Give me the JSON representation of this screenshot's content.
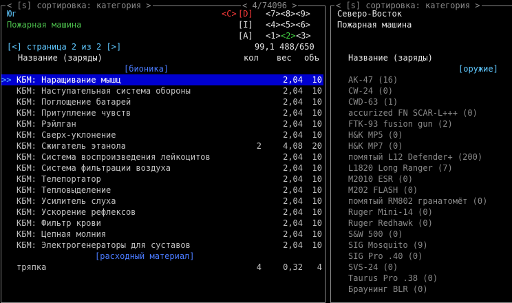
{
  "left_panel": {
    "header": "< [s] сортировка: категория >",
    "counter": "< 4/74096 >",
    "location": "Юг",
    "vehicle": "Пожарная машина",
    "key_c": "<C>",
    "key_d": "[D]",
    "key_i": "[I]",
    "key_a": "[A]",
    "nums_row1": "<7><8><9>",
    "nums_row2": "<4><5><6>",
    "nums_row3_a": "<1>",
    "nums_row3_b": "<2>",
    "nums_row3_c": "<3>",
    "page_nav": "[<] страница 2 из 2 [>]",
    "totals": "99,1 488/650",
    "col_name": "Название (заряды)",
    "col_kol": "кол",
    "col_ves": "вес",
    "col_obj": "объ",
    "category_bionics": "[бионика]",
    "category_consumable": "[расходный материал]",
    "selection_marker": ">>",
    "items": [
      {
        "name": "КБМ: Наращивание мышц",
        "kol": "",
        "ves": "2,04",
        "obj": "10"
      },
      {
        "name": "КБМ: Наступательная система обороны",
        "kol": "",
        "ves": "2,04",
        "obj": "10"
      },
      {
        "name": "КБМ: Поглощение батарей",
        "kol": "",
        "ves": "2,04",
        "obj": "10"
      },
      {
        "name": "КБМ: Притупление чувств",
        "kol": "",
        "ves": "2,04",
        "obj": "10"
      },
      {
        "name": "КБМ: Рэйлган",
        "kol": "",
        "ves": "2,04",
        "obj": "10"
      },
      {
        "name": "КБМ: Сверх-уклонение",
        "kol": "",
        "ves": "2,04",
        "obj": "10"
      },
      {
        "name": "КБМ: Сжигатель этанола",
        "kol": "2",
        "ves": "4,08",
        "obj": "20"
      },
      {
        "name": "КБМ: Система воспроизведения лейкоцитов",
        "kol": "",
        "ves": "2,04",
        "obj": "10"
      },
      {
        "name": "КБМ: Система фильтрации воздуха",
        "kol": "",
        "ves": "2,04",
        "obj": "10"
      },
      {
        "name": "КБМ: Телепортатор",
        "kol": "",
        "ves": "2,04",
        "obj": "10"
      },
      {
        "name": "КБМ: Тепловыделение",
        "kol": "",
        "ves": "2,04",
        "obj": "10"
      },
      {
        "name": "КБМ: Усилитель слуха",
        "kol": "",
        "ves": "2,04",
        "obj": "10"
      },
      {
        "name": "КБМ: Ускорение рефлексов",
        "kol": "",
        "ves": "2,04",
        "obj": "10"
      },
      {
        "name": "КБМ: Фильтр крови",
        "kol": "",
        "ves": "2,04",
        "obj": "10"
      },
      {
        "name": "КБМ: Цепная молния",
        "kol": "",
        "ves": "2,04",
        "obj": "10"
      },
      {
        "name": "КБМ: Электрогенераторы для суставов",
        "kol": "",
        "ves": "2,04",
        "obj": "10"
      }
    ],
    "consumables": [
      {
        "name": "тряпка",
        "kol": "4",
        "ves": "0,32",
        "obj": "4"
      }
    ]
  },
  "right_panel": {
    "header": "< [s] сортировка: категория >",
    "location": "Северо-Восток",
    "vehicle": "Пожарная машина",
    "col_name": "Название (заряды)",
    "category_weapons": "[оружие]",
    "items": [
      "AK-47 (16)",
      "CW-24 (0)",
      "CWD-63 (1)",
      "accurized FN SCAR-L+++ (0)",
      "FTK-93 fusion gun (2)",
      "H&K MP5 (0)",
      "H&K MP7 (0)",
      "помятый L12 Defender+ (200)",
      "L1820 Long Ranger (7)",
      "M2010 ESR (0)",
      "M202 FLASH (0)",
      "помятый RM802 гранатомёт (0)",
      "Ruger Mini-14 (0)",
      "Ruger Redhawk (0)",
      "S&W 500 (0)",
      "SIG Mosquito (9)",
      "SIG Pro .40 (0)",
      "SVS-24 (0)",
      "Taurus Pro .38 (0)",
      "Браунинг BLR (0)"
    ]
  }
}
